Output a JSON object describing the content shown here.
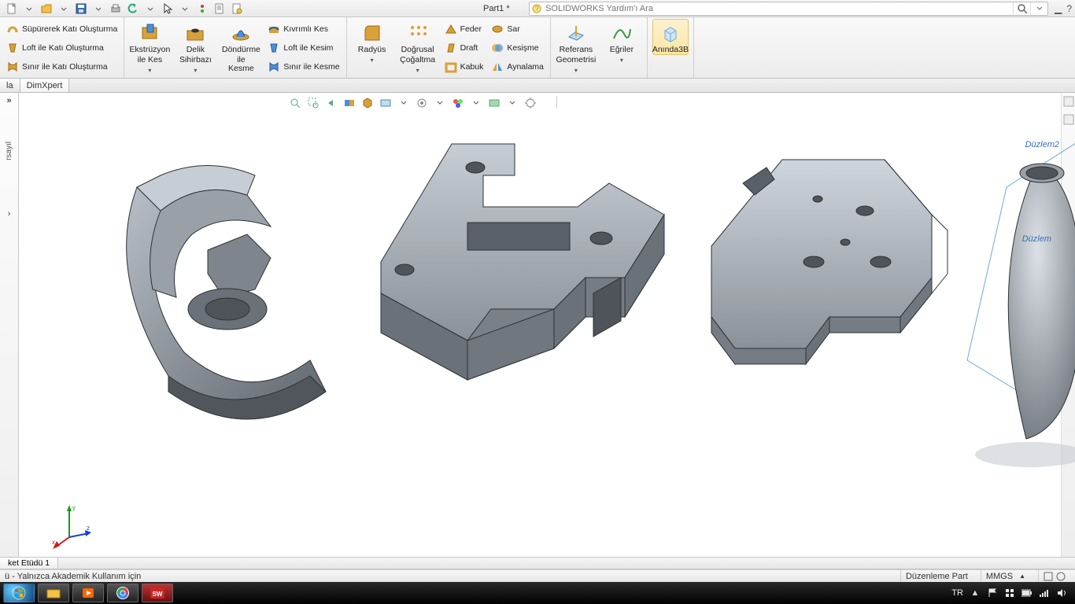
{
  "title": "Part1 *",
  "search": {
    "placeholder": "SOLIDWORKS Yardım'ı Ara"
  },
  "ribbon": {
    "features_stack": [
      "Süpürerek Katı Oluşturma",
      "Loft ile Katı Oluşturma",
      "Sınır ile Katı Oluşturma"
    ],
    "ext_cut": {
      "l1": "Ekstrüzyon",
      "l2": "ile Kes"
    },
    "hole": {
      "l1": "Delik",
      "l2": "Sihirbazı"
    },
    "rev_cut": {
      "l1": "Döndürme",
      "l2": "ile Kesme"
    },
    "cut_stack": [
      "Kıvrımlı Kes",
      "Loft ile Kesim",
      "Sınır ile Kesme"
    ],
    "fillet": "Radyüs",
    "pattern": {
      "l1": "Doğrusal",
      "l2": "Çoğaltma"
    },
    "mod_stack1": [
      "Feder",
      "Draft",
      "Kabuk"
    ],
    "mod_stack2": [
      "Sar",
      "Kesişme",
      "Aynalama"
    ],
    "refgeo": {
      "l1": "Referans",
      "l2": "Geometrisi"
    },
    "curves": "Eğriler",
    "instant3d": "Anında3B"
  },
  "tabs": {
    "t1": "la",
    "t2": "DimXpert"
  },
  "left": {
    "collapse": "»",
    "label": "rsayıl",
    "arrow": "›"
  },
  "modeltab": "ket Etüdü 1",
  "status": {
    "left": "ü - Yalnızca Akademik Kullanım için",
    "mode": "Düzenleme Part",
    "units": "MMGS",
    "arrow": "▲"
  },
  "viewport": {
    "plane2": "Düzlem2",
    "plane3": "Düzlem"
  },
  "taskbar": {
    "lang": "TR",
    "up": "▲"
  }
}
